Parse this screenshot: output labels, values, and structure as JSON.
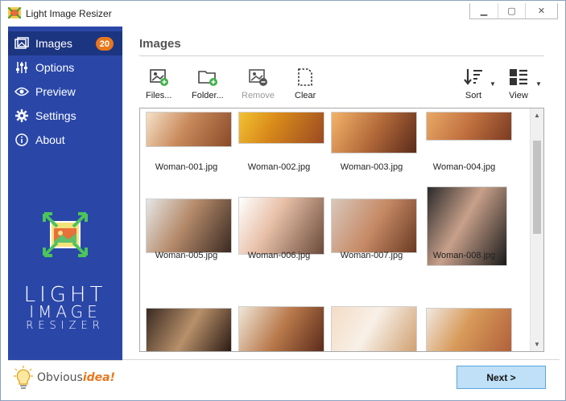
{
  "window": {
    "title": "Light Image Resizer",
    "controls": {
      "minimize": "▁",
      "restore": "▢",
      "close": "✕"
    }
  },
  "sidebar": {
    "items": [
      {
        "label": "Images",
        "icon": "images-icon",
        "badge": "20",
        "active": true
      },
      {
        "label": "Options",
        "icon": "sliders-icon"
      },
      {
        "label": "Preview",
        "icon": "eye-icon"
      },
      {
        "label": "Settings",
        "icon": "gear-icon"
      },
      {
        "label": "About",
        "icon": "info-icon"
      }
    ],
    "logo": {
      "line1": "LIGHT",
      "line2": "IMAGE",
      "line3": "RESIZER"
    },
    "brand": {
      "part1": "Obvious",
      "part2": "idea!"
    }
  },
  "main": {
    "title": "Images",
    "toolbar": {
      "files": "Files...",
      "folder": "Folder...",
      "remove": "Remove",
      "clear": "Clear",
      "sort": "Sort",
      "view": "View"
    },
    "images": [
      {
        "name": "Woman-001.jpg"
      },
      {
        "name": "Woman-002.jpg"
      },
      {
        "name": "Woman-003.jpg"
      },
      {
        "name": "Woman-004.jpg"
      },
      {
        "name": "Woman-005.jpg"
      },
      {
        "name": "Woman-006.jpg"
      },
      {
        "name": "Woman-007.jpg"
      },
      {
        "name": "Woman-008.jpg"
      },
      {
        "name": ""
      },
      {
        "name": ""
      },
      {
        "name": ""
      },
      {
        "name": ""
      }
    ]
  },
  "footer": {
    "next": "Next >"
  },
  "colors": {
    "sidebar": "#2a47a8",
    "sidebar_active": "#1c3580",
    "badge": "#e8771d",
    "next_button": "#bfe0f7"
  }
}
